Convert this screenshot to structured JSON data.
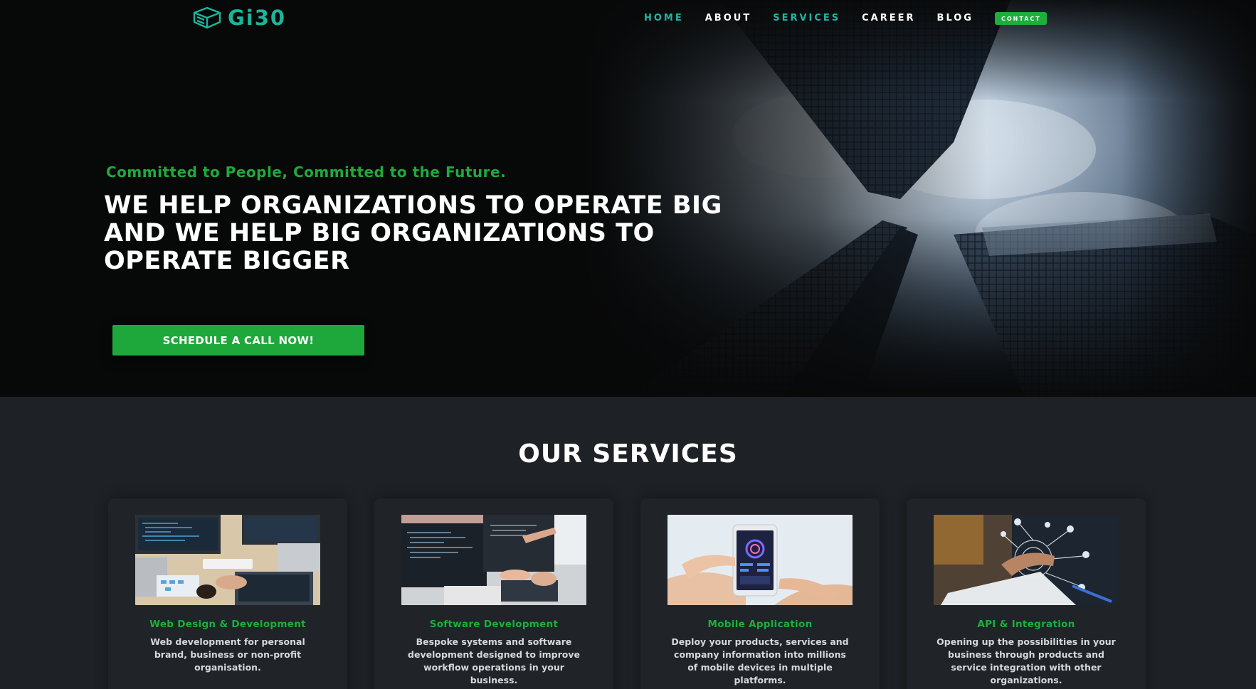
{
  "brand": {
    "logo_text": "Gi30",
    "accent_color": "#1bb59a"
  },
  "nav": {
    "items": [
      {
        "label": "HOME",
        "active": true
      },
      {
        "label": "ABOUT",
        "active": false
      },
      {
        "label": "SERVICES",
        "active": true
      },
      {
        "label": "CAREER",
        "active": false
      },
      {
        "label": "BLOG",
        "active": false
      }
    ],
    "contact_label": "CONTACT"
  },
  "hero": {
    "tagline": "Committed to People, Committed to the Future.",
    "headline": "WE HELP ORGANIZATIONS TO OPERATE BIG AND WE HELP BIG ORGANIZATIONS TO OPERATE BIGGER",
    "cta_label": "SCHEDULE A CALL NOW!",
    "background_image": "skyscrapers-looking-up"
  },
  "services": {
    "title": "OUR SERVICES",
    "cards": [
      {
        "title": "Web Design & Development",
        "description": "Web development for personal brand, business or non-profit organisation.",
        "image": "laptops-desk-coding"
      },
      {
        "title": "Software Development",
        "description": "Bespoke systems and software development designed to improve workflow operations in your business.",
        "image": "developer-monitors-code"
      },
      {
        "title": "Mobile Application",
        "description": "Deploy your products, services and company information into millions of mobile devices in multiple platforms.",
        "image": "hand-holding-smartphone"
      },
      {
        "title": "API & Integration",
        "description": "Opening up the possibilities in your business through products and service integration with other organizations.",
        "image": "network-integration-hand"
      }
    ]
  },
  "colors": {
    "green": "#1ea73a",
    "teal": "#20b5a3",
    "dark_bg": "#070808",
    "section_bg": "#1e2125"
  }
}
